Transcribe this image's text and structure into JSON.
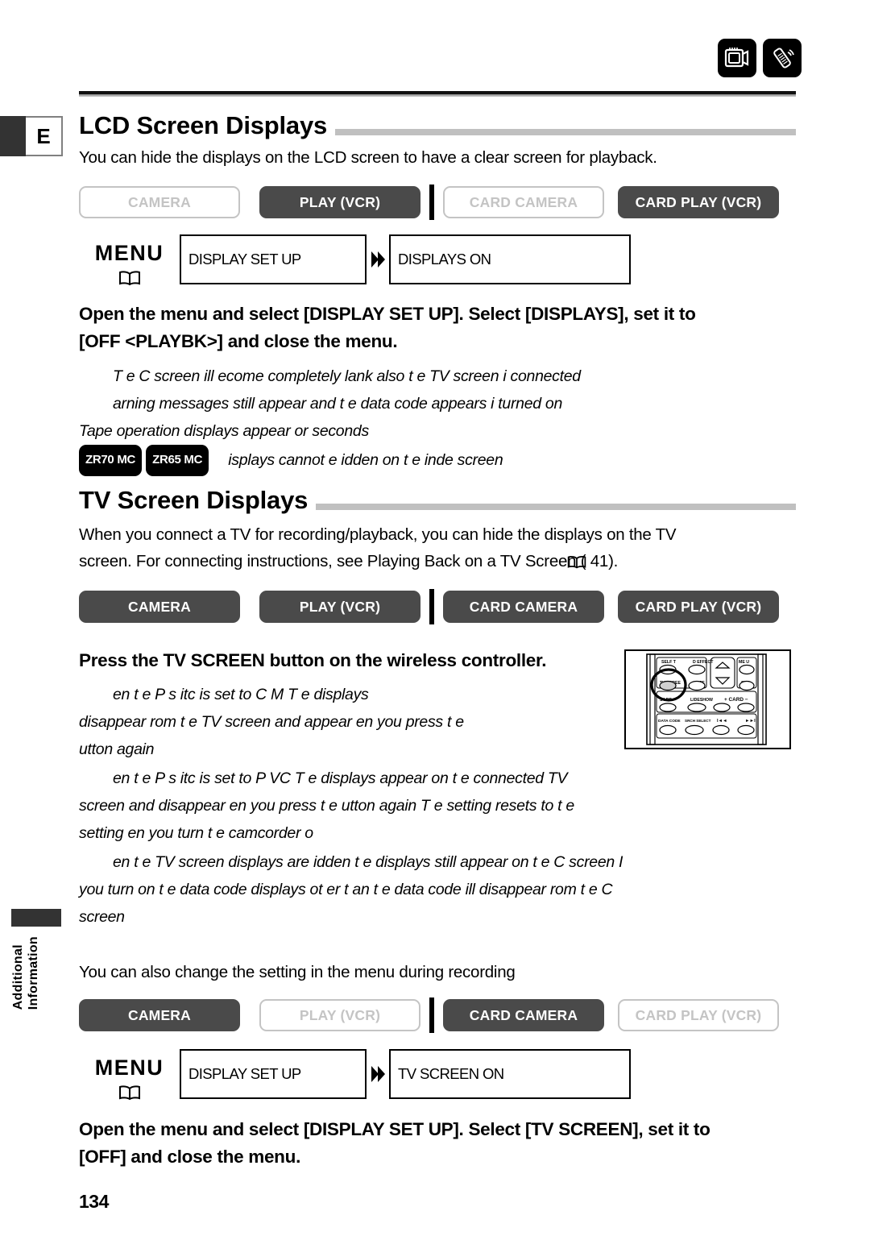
{
  "page": {
    "number": "134",
    "tab_letter": "E",
    "sidebar_label_line1": "Additional",
    "sidebar_label_line2": "Information"
  },
  "top_icons": [
    {
      "name": "tv-monitor-icon",
      "label": "TV screen"
    },
    {
      "name": "wireless-remote-icon",
      "label": "Wireless controller"
    }
  ],
  "sections": [
    {
      "heading": "LCD Screen Displays",
      "intro": "You can hide the displays on the LCD screen to have a clear screen for playback.",
      "modes": [
        {
          "label": "CAMERA",
          "active": false
        },
        {
          "label": "PLAY (VCR)",
          "active": true
        },
        {
          "label": "CARD CAMERA",
          "active": false
        },
        {
          "label": "CARD PLAY (VCR)",
          "active": true
        }
      ],
      "menu": {
        "title": "MENU",
        "box1": "DISPLAY SET UP",
        "box2": "DISPLAYS   ON"
      },
      "instruction_line1": "Open the menu and select [DISPLAY SET UP]. Select [DISPLAYS], set it to",
      "instruction_line2": "[OFF <PLAYBK>] and close the menu.",
      "notes": [
        "T e C  screen  ill  ecome completely  lank  also t e TV screen i  connected",
        " arning messages still appear  and t e data code appears i  turned on",
        "Tape operation displays appear  or   seconds"
      ],
      "model_note": {
        "badges": [
          "ZR70 MC",
          "ZR65 MC"
        ],
        "text": " isplays cannot  e  idden on t e inde  screen"
      }
    },
    {
      "heading": "TV Screen Displays",
      "intro_line1": "When you connect a TV for recording/playback, you can hide the displays on the TV",
      "intro_line2": "screen. For connecting instructions, see Playing Back on a TV Screen (     41).",
      "modes": [
        {
          "label": "CAMERA",
          "active": true
        },
        {
          "label": "PLAY (VCR)",
          "active": true
        },
        {
          "label": "CARD CAMERA",
          "active": true
        },
        {
          "label": "CARD PLAY (VCR)",
          "active": true
        }
      ],
      "instruction": "Press the TV SCREEN button on the wireless controller.",
      "notes_group1": [
        " en t e P      s  itc  is set to C  M      T e displays",
        "disappear  rom t e TV screen and appear    en you press t e",
        " utton again"
      ],
      "notes_group2": [
        " en t e P      s  itc  is set to P    VC   T e displays appear on t e connected TV",
        "screen and disappear    en you press t e  utton again  T e setting resets to t e",
        "setting    en you turn t e camcorder o"
      ],
      "notes_group3": [
        " en t e TV screen displays are  idden  t e displays still appear on t e  C  screen  I",
        "you turn on t e data code  displays ot er t an t e data code  ill disappear  rom t e  C",
        "screen"
      ],
      "closing_note": "You can also change the setting in the menu during recording",
      "modes2": [
        {
          "label": "CAMERA",
          "active": true
        },
        {
          "label": "PLAY (VCR)",
          "active": false
        },
        {
          "label": "CARD CAMERA",
          "active": true
        },
        {
          "label": "CARD PLAY (VCR)",
          "active": false
        }
      ],
      "menu2": {
        "title": "MENU",
        "box1": "DISPLAY SET UP",
        "box2": "TV SCREEN   ON"
      },
      "instruction2_line1": "Open the menu and select [DISPLAY SET UP]. Select [TV SCREEN], set it to",
      "instruction2_line2": "[OFF] and close the menu."
    }
  ],
  "remote": {
    "callout_button": "TV SCREE",
    "buttons": [
      "SELF T",
      "D EFFECT",
      "ME U",
      "TV SCREE",
      " /OFF",
      "SET",
      "S I DE",
      "LIDESHOW",
      "+ CARD -",
      "DATA CODE",
      "SRCH SELECT"
    ]
  }
}
